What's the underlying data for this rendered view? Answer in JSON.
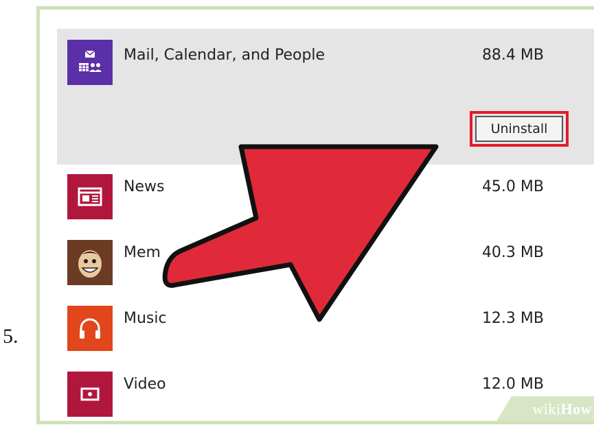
{
  "step": {
    "number": "5."
  },
  "apps": [
    {
      "name": "Mail, Calendar, and People",
      "size": "88.4 MB",
      "icon": "mail-calendar-people-icon",
      "color": "#5b2fa8",
      "selected": true
    },
    {
      "name": "News",
      "size": "45.0 MB",
      "icon": "news-icon",
      "color": "#b1173d",
      "selected": false
    },
    {
      "name": "Mem",
      "size": "40.3 MB",
      "icon": "meme-face-icon",
      "color": "#6b3b24",
      "selected": false
    },
    {
      "name": "Music",
      "size": "12.3 MB",
      "icon": "headphones-icon",
      "color": "#e2461c",
      "selected": false
    },
    {
      "name": "Video",
      "size": "12.0 MB",
      "icon": "video-icon",
      "color": "#b1173d",
      "selected": false
    }
  ],
  "uninstall": {
    "label": "Uninstall",
    "highlight_color": "#e21b2a"
  },
  "arrow": {
    "color": "#e02a3a",
    "outline": "#111111",
    "points_to": "uninstall-button"
  },
  "watermark": {
    "prefix": "wiki",
    "suffix": "How"
  }
}
